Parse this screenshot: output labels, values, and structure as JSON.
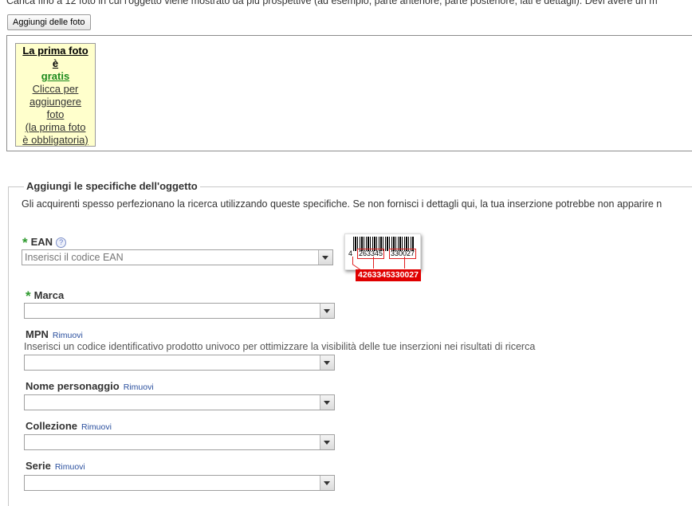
{
  "intro": "Carica fino a 12 foto in cui l'oggetto viene mostrato da più prospettive (ad esempio, parte anteriore, parte posteriore, lati e dettagli).  Devi avere un m",
  "add_photos_button": "Aggiungi delle foto",
  "photo_slot": {
    "line1": "La prima foto",
    "line2": "è",
    "line3": "gratis",
    "line4": "Clicca per",
    "line5": "aggiungere",
    "line6": "foto",
    "line7": "(la prima foto",
    "line8": "è obbligatoria)"
  },
  "specs": {
    "title": "Aggiungi le specifiche dell'oggetto",
    "description": "Gli acquirenti spesso perfezionano la ricerca utilizzando queste specifiche. Se non fornisci i dettagli qui, la tua inserzione potrebbe non apparire n"
  },
  "fields": {
    "ean": {
      "required_mark": "*",
      "label": "EAN",
      "help": "?",
      "placeholder": "Inserisci il codice EAN",
      "value": ""
    },
    "marca": {
      "required_mark": "*",
      "label": "Marca",
      "value": ""
    },
    "mpn": {
      "label": "MPN",
      "remove": "Rimuovi",
      "hint": "Inserisci un codice identificativo prodotto univoco per ottimizzare la visibilità delle tue inserzioni nei risultati di ricerca",
      "value": ""
    },
    "nome_personaggio": {
      "label": "Nome personaggio",
      "remove": "Rimuovi",
      "value": ""
    },
    "collezione": {
      "label": "Collezione",
      "remove": "Rimuovi",
      "value": ""
    },
    "serie": {
      "label": "Serie",
      "remove": "Rimuovi",
      "value": ""
    }
  },
  "barcode": {
    "first_digit": "4",
    "group1": "263345",
    "group2": "330027",
    "full": "4263345330027"
  },
  "colors": {
    "required": "#2e9a2e",
    "link": "#2a4f9e",
    "barcode_tag": "#e00000",
    "photo_slot_bg": "#ffffcc"
  }
}
